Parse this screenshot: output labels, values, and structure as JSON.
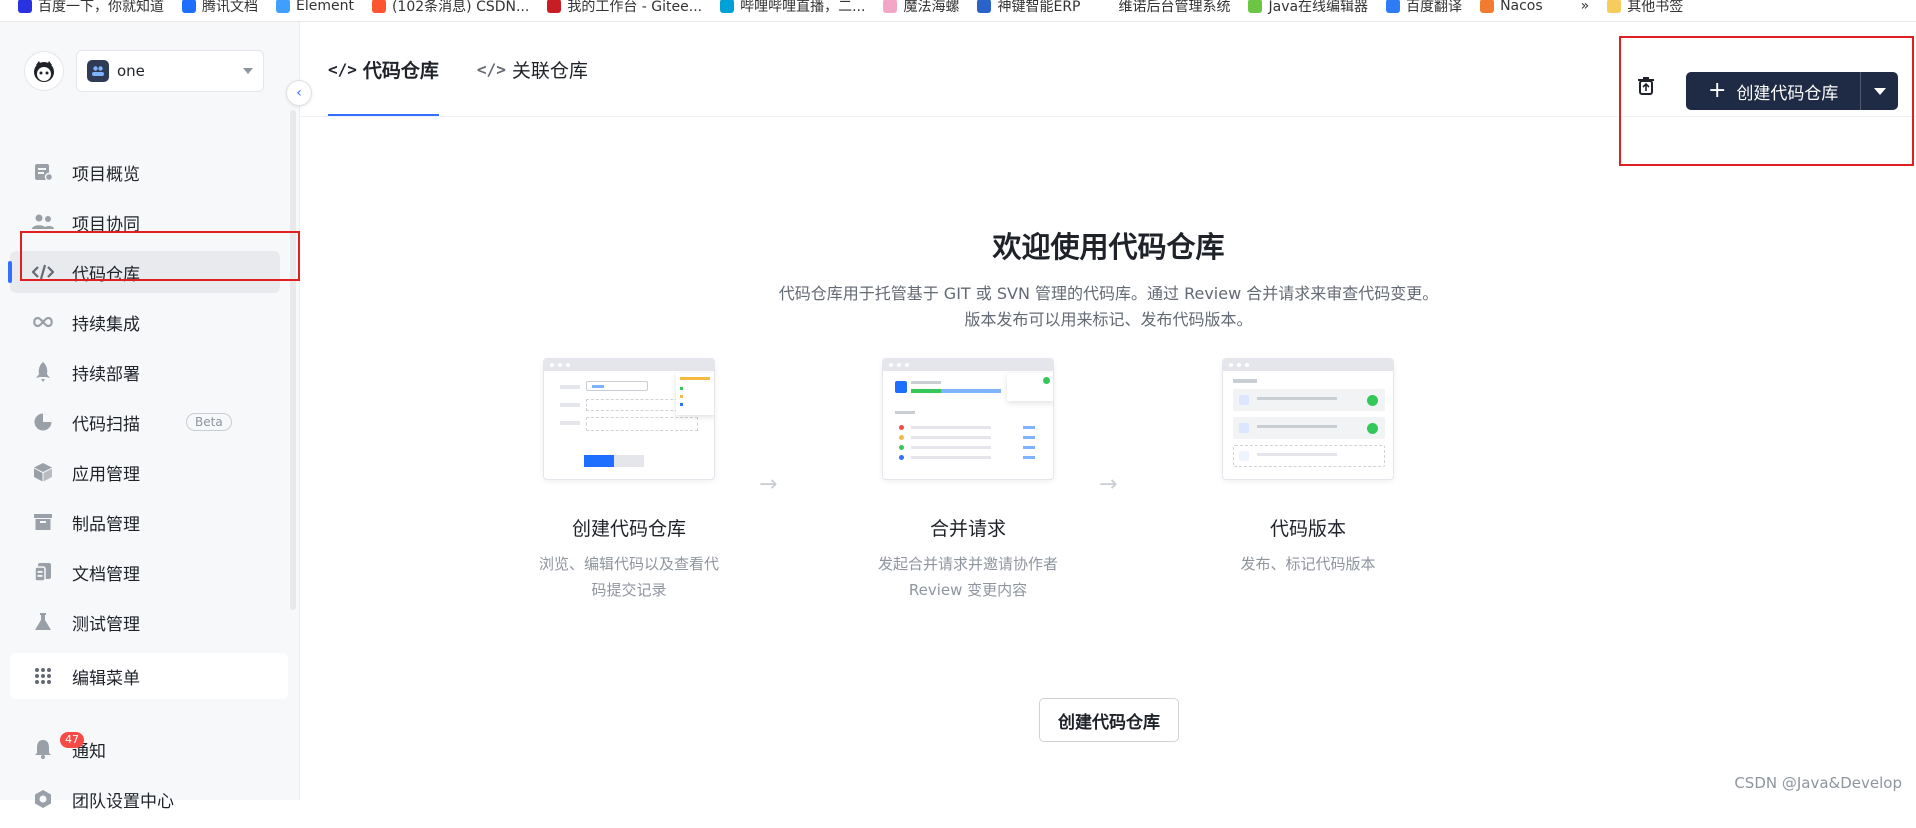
{
  "bookmarks": [
    {
      "label": "百度一下，你就知道",
      "color": "#2932e1"
    },
    {
      "label": "腾讯文档",
      "color": "#1e6fff"
    },
    {
      "label": "Element",
      "color": "#409eff"
    },
    {
      "label": "(102条消息) CSDN...",
      "color": "#fc5531"
    },
    {
      "label": "我的工作台 - Gitee...",
      "color": "#c71d23"
    },
    {
      "label": "哔哩哔哩直播，二...",
      "color": "#00a1d6"
    },
    {
      "label": "魔法海螺",
      "color": "#f4a6c8"
    },
    {
      "label": "神键智能ERP",
      "color": "#2a62c9"
    },
    {
      "label": "维诺后台管理系统",
      "color": "#ffffff"
    },
    {
      "label": "Java在线编辑器",
      "color": "#6cc644"
    },
    {
      "label": "百度翻译",
      "color": "#2e7bf6"
    },
    {
      "label": "Nacos",
      "color": "#f27b2f"
    },
    {
      "label": "»",
      "color": "#ffffff"
    },
    {
      "label": "其他书签",
      "color": "#f6cd5c"
    }
  ],
  "sidebar": {
    "project": "one",
    "nav": [
      {
        "label": "项目概览",
        "icon": "project-overview-icon"
      },
      {
        "label": "项目协同",
        "icon": "collaboration-icon"
      },
      {
        "label": "代码仓库",
        "icon": "code-icon",
        "active": true
      },
      {
        "label": "持续集成",
        "icon": "infinity-icon"
      },
      {
        "label": "持续部署",
        "icon": "rocket-icon"
      },
      {
        "label": "代码扫描",
        "icon": "pie-icon",
        "badge": "Beta"
      },
      {
        "label": "应用管理",
        "icon": "cube-icon"
      },
      {
        "label": "制品管理",
        "icon": "archive-icon"
      },
      {
        "label": "文档管理",
        "icon": "document-icon"
      },
      {
        "label": "测试管理",
        "icon": "flask-icon"
      }
    ],
    "edit_menu": "编辑菜单",
    "notifications": {
      "label": "通知",
      "count": "47"
    },
    "team_settings": "团队设置中心"
  },
  "header": {
    "tabs": [
      {
        "label": "代码仓库",
        "active": true
      },
      {
        "label": "关联仓库",
        "active": false
      }
    ],
    "create_button": "创建代码仓库"
  },
  "welcome": {
    "title": "欢迎使用代码仓库",
    "desc1": "代码仓库用于托管基于 GIT 或 SVN 管理的代码库。通过 Review 合并请求来审查代码变更。",
    "desc2": "版本发布可以用来标记、发布代码版本。",
    "cards": [
      {
        "title": "创建代码仓库",
        "desc": "浏览、编辑代码以及查看代码提交记录"
      },
      {
        "title": "合并请求",
        "desc": "发起合并请求并邀请协作者 Review 变更内容"
      },
      {
        "title": "代码版本",
        "desc": "发布、标记代码版本"
      }
    ],
    "cta": "创建代码仓库"
  },
  "watermark": "CSDN @Java&Develop",
  "colors": {
    "accent": "#3370ff",
    "primary_button": "#1f2a44",
    "highlight": "#e02020"
  }
}
